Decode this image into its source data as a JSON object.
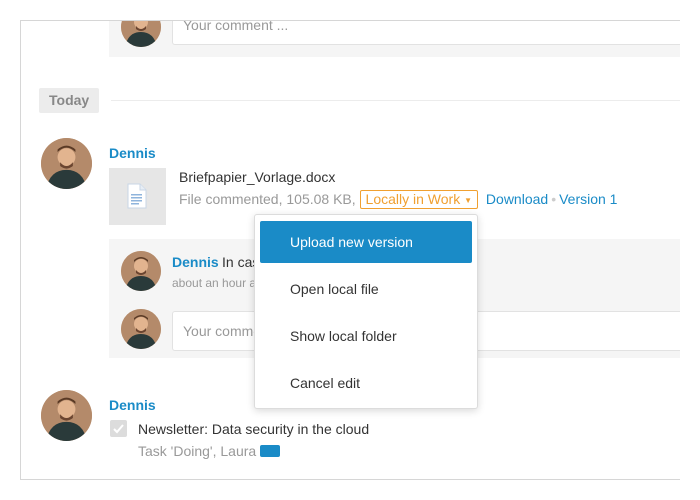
{
  "colors": {
    "accent": "#1a8bc7",
    "badge": "#f0a030",
    "tag": "#1a8bc7"
  },
  "comment_placeholder": "Your comment ...",
  "day_label": "Today",
  "activity1": {
    "author": "Dennis",
    "file_name": "Briefpapier_Vorlage.docx",
    "meta_text": "File commented, 105.08 KB,",
    "status_badge": "Locally in Work",
    "download_label": "Download",
    "separator": "•",
    "version_label": "Version 1",
    "file_icon": "document-icon",
    "reply": {
      "author": "Dennis",
      "text_visible": "In cas",
      "time_visible": "about an hour a"
    },
    "reply_placeholder_visible": "Your comme"
  },
  "menu": {
    "items": [
      {
        "label": "Upload new version",
        "active": true
      },
      {
        "label": "Open local file",
        "active": false
      },
      {
        "label": "Show local folder",
        "active": false
      },
      {
        "label": "Cancel edit",
        "active": false
      }
    ]
  },
  "activity2": {
    "author": "Dennis",
    "task_title": "Newsletter: Data security in the cloud",
    "task_meta": "Task 'Doing', Laura"
  }
}
